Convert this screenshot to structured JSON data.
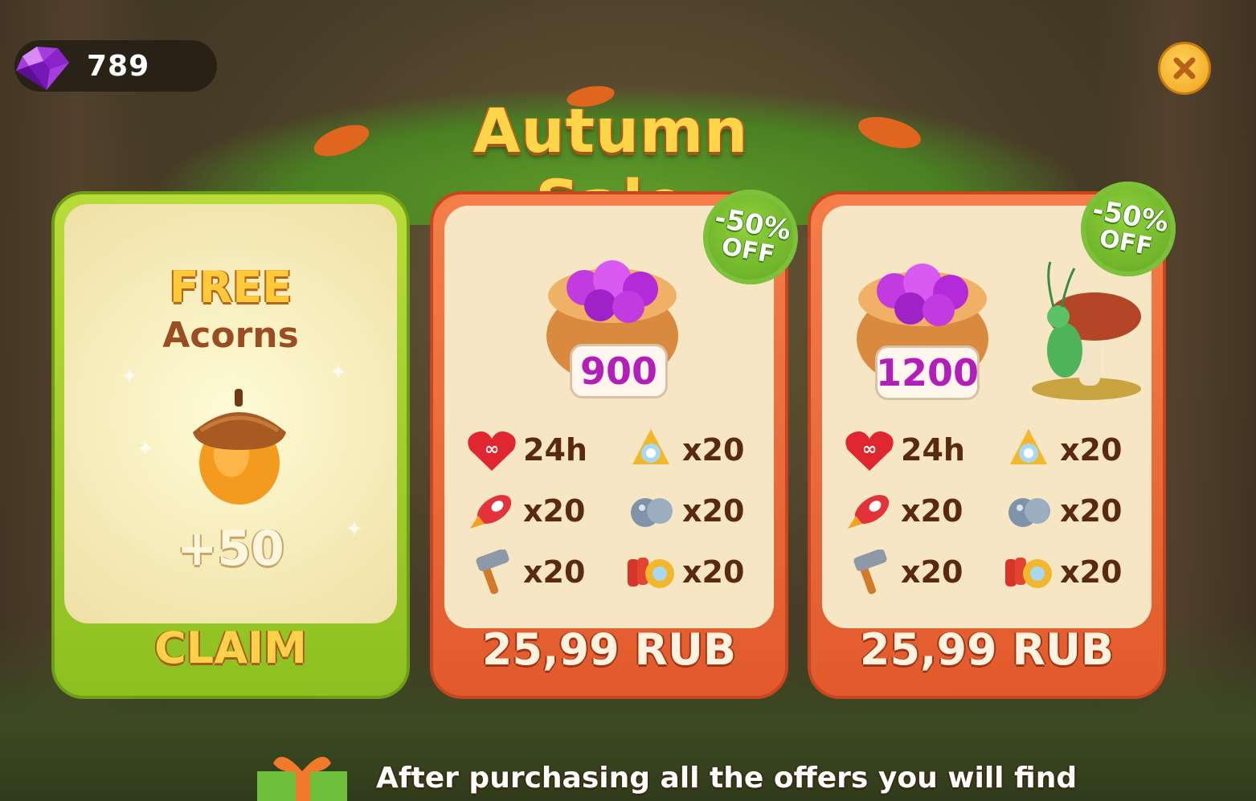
{
  "wallet": {
    "gems": "789"
  },
  "title": "Autumn Sale",
  "free_offer": {
    "title": "FREE",
    "subtitle": "Acorns",
    "amount": "+50",
    "action": "CLAIM"
  },
  "offers": [
    {
      "badge_line1": "-50%",
      "badge_line2": "OFF",
      "gems_amount": "900",
      "items": [
        {
          "icon": "infinite-lives-heart-icon",
          "value": "24h"
        },
        {
          "icon": "propeller-booster-icon",
          "value": "x20"
        },
        {
          "icon": "rocket-booster-icon",
          "value": "x20"
        },
        {
          "icon": "bomb-booster-icon",
          "value": "x20"
        },
        {
          "icon": "hammer-icon",
          "value": "x20"
        },
        {
          "icon": "dynamite-booster-icon",
          "value": "x20"
        }
      ],
      "price": "25,99 RUB"
    },
    {
      "badge_line1": "-50%",
      "badge_line2": "OFF",
      "gems_amount": "1200",
      "items": [
        {
          "icon": "infinite-lives-heart-icon",
          "value": "24h"
        },
        {
          "icon": "propeller-booster-icon",
          "value": "x20"
        },
        {
          "icon": "rocket-booster-icon",
          "value": "x20"
        },
        {
          "icon": "bomb-booster-icon",
          "value": "x20"
        },
        {
          "icon": "hammer-icon",
          "value": "x20"
        },
        {
          "icon": "dynamite-booster-icon",
          "value": "x20"
        }
      ],
      "price": "25,99 RUB"
    }
  ],
  "footer": {
    "text": "After purchasing all the offers you will find"
  },
  "colors": {
    "title": "#ffd64a",
    "free_card": "#a6d02c",
    "offer_card": "#ee6a38",
    "badge": "#6fb82a",
    "gem_tag_text": "#b21fb8"
  }
}
